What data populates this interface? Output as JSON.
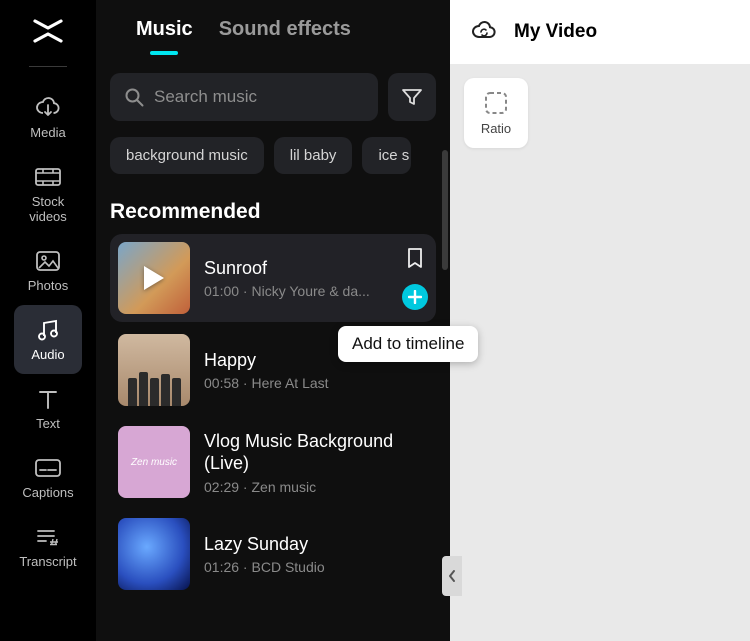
{
  "sidebar": {
    "items": [
      {
        "label": "Media",
        "icon": "cloud-download-icon"
      },
      {
        "label": "Stock videos",
        "icon": "filmstrip-icon"
      },
      {
        "label": "Photos",
        "icon": "image-icon"
      },
      {
        "label": "Audio",
        "icon": "music-note-icon",
        "active": true
      },
      {
        "label": "Text",
        "icon": "text-icon"
      },
      {
        "label": "Captions",
        "icon": "captions-icon"
      },
      {
        "label": "Transcript",
        "icon": "transcript-icon"
      }
    ]
  },
  "panel": {
    "tabs": [
      {
        "label": "Music",
        "active": true
      },
      {
        "label": "Sound effects",
        "active": false
      }
    ],
    "search_placeholder": "Search music",
    "chips": [
      "background music",
      "lil baby",
      "ice s"
    ],
    "section_title": "Recommended",
    "tooltip": "Add to timeline",
    "tracks": [
      {
        "title": "Sunroof",
        "duration": "01:00",
        "artist": "Nicky Youre & da...",
        "hover": true
      },
      {
        "title": "Happy",
        "duration": "00:58",
        "artist": "Here At Last"
      },
      {
        "title": "Vlog Music Background (Live)",
        "duration": "02:29",
        "artist": "Zen music"
      },
      {
        "title": "Lazy Sunday",
        "duration": "01:26",
        "artist": "BCD Studio"
      }
    ]
  },
  "preview": {
    "title": "My Video",
    "ratio_label": "Ratio"
  }
}
